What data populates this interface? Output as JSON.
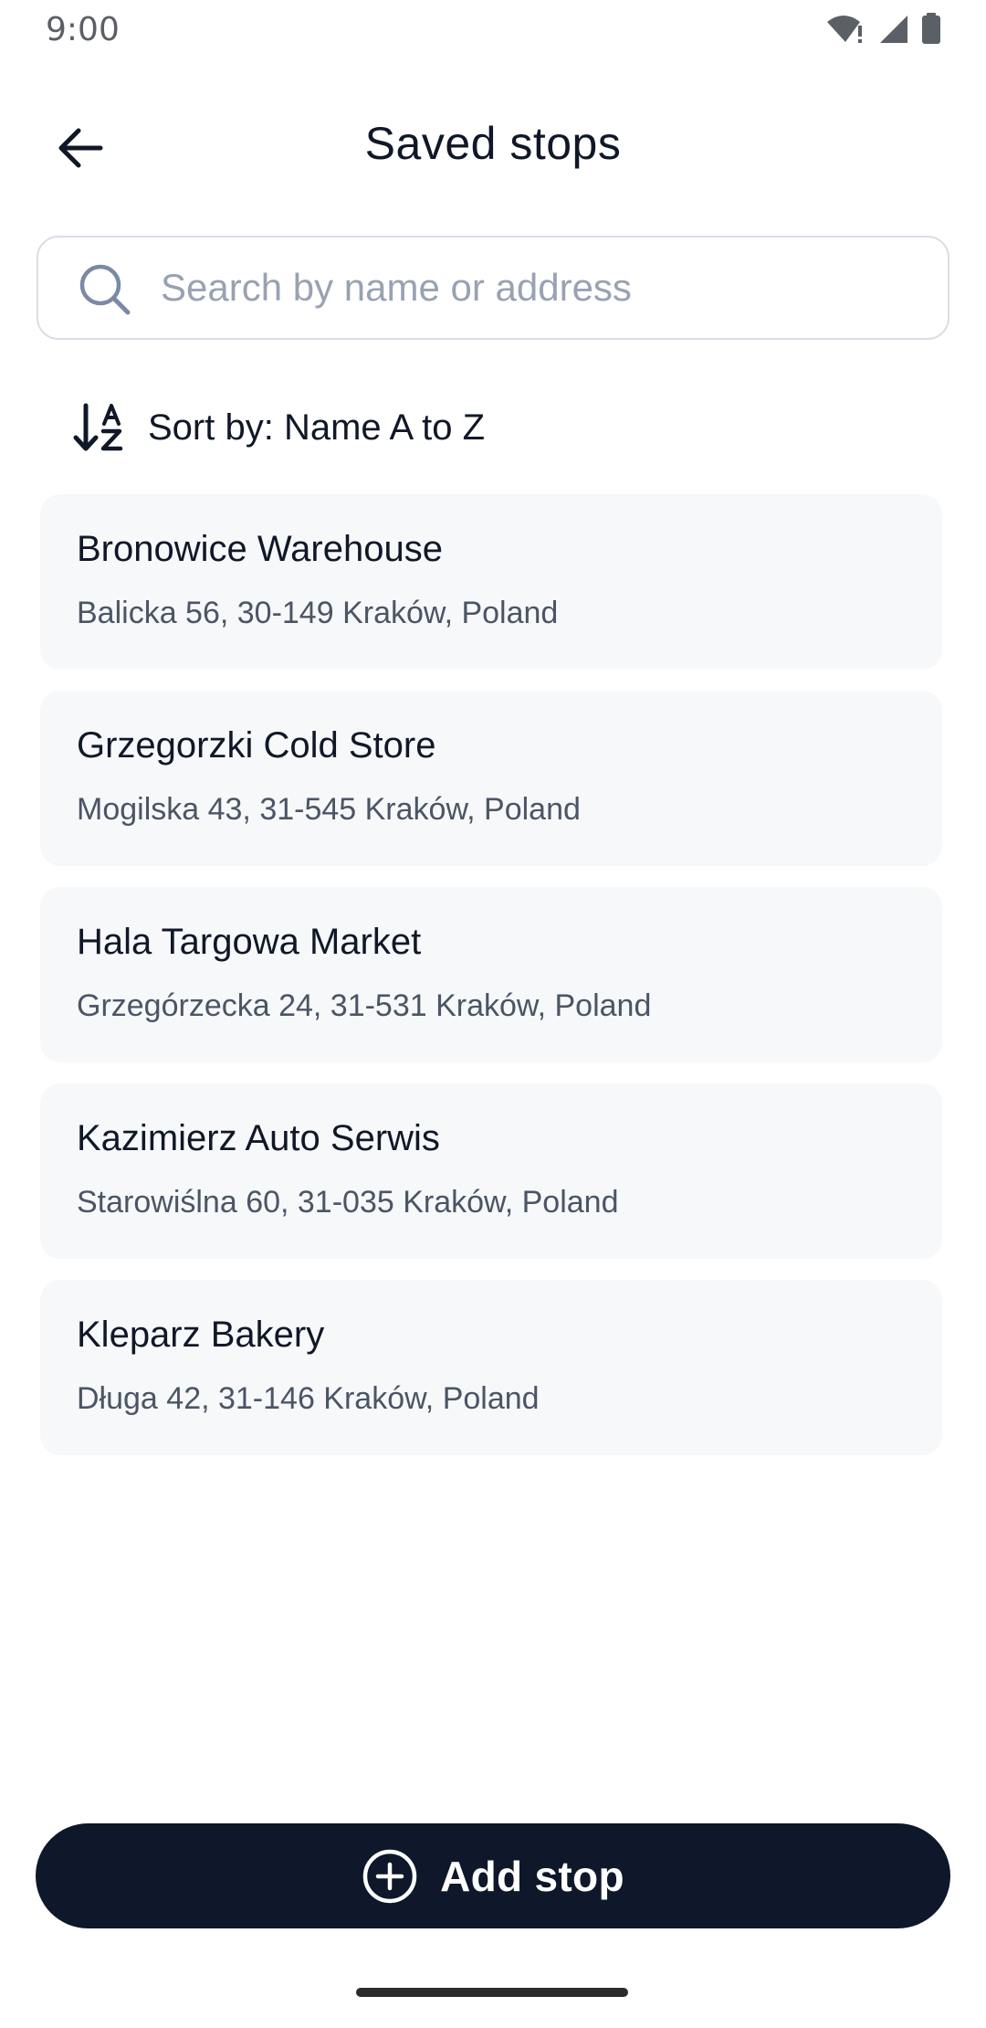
{
  "status_bar": {
    "time": "9:00",
    "icons": [
      "wifi-alert-icon",
      "signal-icon",
      "battery-icon"
    ]
  },
  "header": {
    "title": "Saved stops",
    "back_icon": "arrow-left-icon"
  },
  "search": {
    "placeholder": "Search by name or address",
    "value": "",
    "icon": "search-icon"
  },
  "sort": {
    "label": "Sort by: Name A to Z",
    "icon": "sort-alpha-icon"
  },
  "stops": [
    {
      "name": "Bronowice Warehouse",
      "address": "Balicka 56, 30-149 Kraków, Poland"
    },
    {
      "name": "Grzegorzki Cold Store",
      "address": "Mogilska 43, 31-545 Kraków, Poland"
    },
    {
      "name": "Hala Targowa Market",
      "address": "Grzegórzecka 24, 31-531 Kraków, Poland"
    },
    {
      "name": "Kazimierz Auto Serwis",
      "address": "Starowiślna 60, 31-035 Kraków, Poland"
    },
    {
      "name": "Kleparz Bakery",
      "address": "Długa 42, 31-146 Kraków, Poland"
    }
  ],
  "actions": {
    "add_stop_label": "Add stop",
    "add_icon": "plus-circle-icon"
  },
  "colors": {
    "primary": "#0F172A",
    "card_background": "#F7F8FA",
    "text_primary": "#101828",
    "text_secondary": "#4B5565",
    "placeholder": "#98A2B3",
    "border": "#D9DEE6"
  }
}
